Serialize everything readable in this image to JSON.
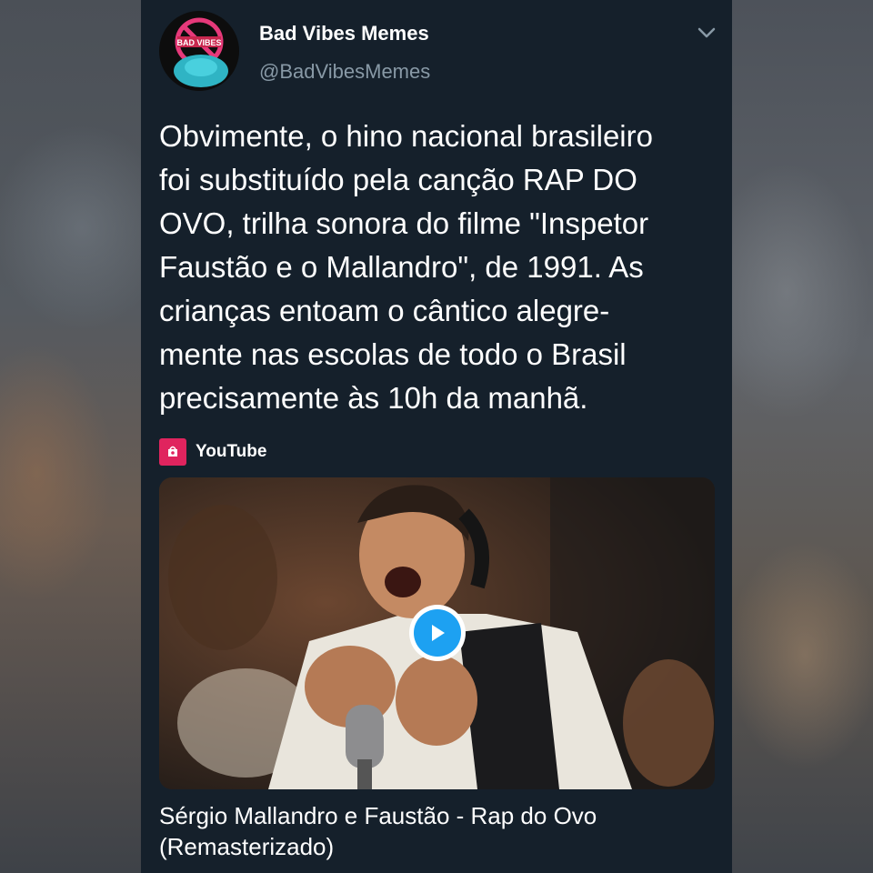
{
  "tweet": {
    "display_name": "Bad Vibes Memes",
    "handle": "@BadVibesMemes",
    "avatar_badge_text": "BAD VIBES",
    "text": "Obvimente, o hino nacional brasileiro\nfoi substituído pela canção RAP DO\nOVO, trilha sonora do filme \"Inspetor\nFaustão e o Mallandro\", de 1991. As\ncrianças entoam o cântico alegre-\nmente nas escolas de todo o Brasil\nprecisamente às 10h da manhã.",
    "menu_icon": "chevron-down-icon"
  },
  "link_card": {
    "source_name": "YouTube",
    "source_icon": "youtube-icon",
    "title": "Sérgio Mallandro e Faustão - Rap do Ovo (Remasterizado)",
    "play_icon": "play-icon"
  },
  "colors": {
    "card_background": "#15202b",
    "text_primary": "#ffffff",
    "text_secondary": "#8899a6",
    "play_accent": "#1da1f2",
    "youtube_red": "#e0245e"
  }
}
